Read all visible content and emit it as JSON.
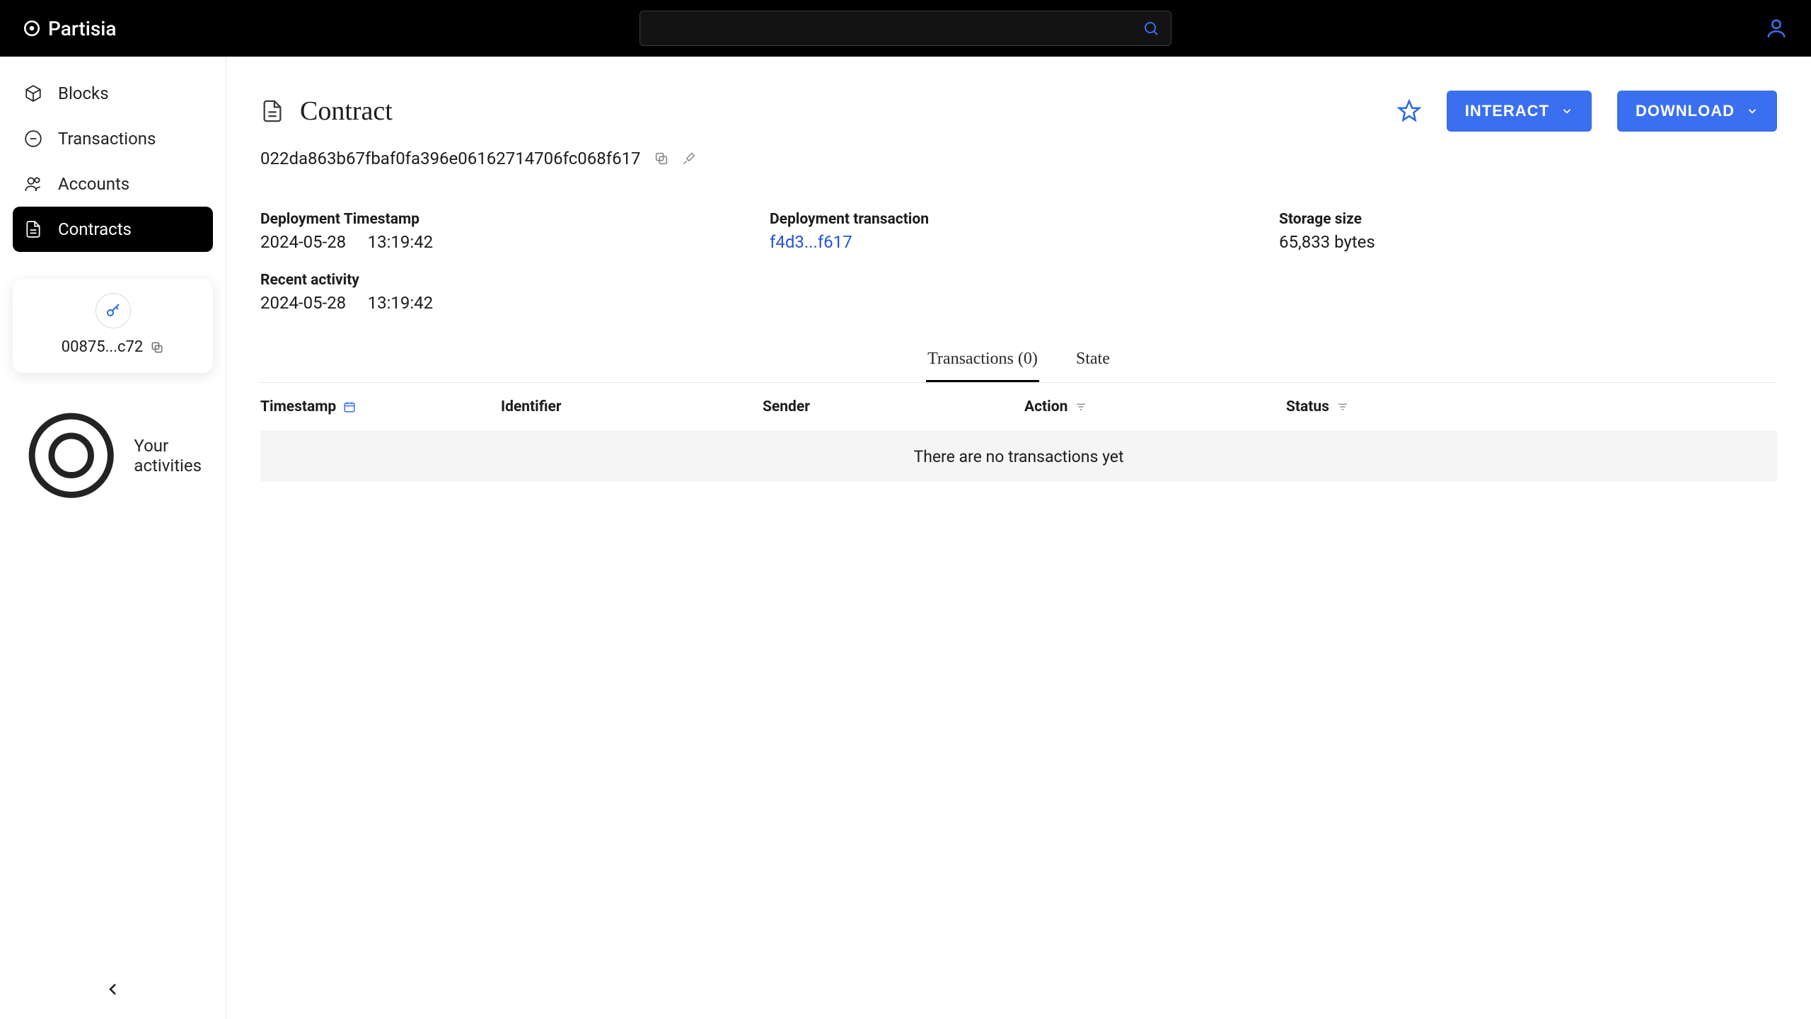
{
  "brand": "Partisia",
  "sidebar": {
    "items": [
      {
        "label": "Blocks"
      },
      {
        "label": "Transactions"
      },
      {
        "label": "Accounts"
      },
      {
        "label": "Contracts"
      }
    ],
    "account": {
      "id": "00875...c72"
    },
    "activities_label": "Your activities"
  },
  "page": {
    "title": "Contract",
    "id": "022da863b67fbaf0fa396e06162714706fc068f617",
    "interact_btn": "INTERACT",
    "download_btn": "DOWNLOAD"
  },
  "info": {
    "deploy_ts_label": "Deployment Timestamp",
    "deploy_ts_value": "2024-05-28  13:19:42",
    "deploy_tx_label": "Deployment transaction",
    "deploy_tx_value": "f4d3...f617",
    "storage_label": "Storage size",
    "storage_value": "65,833 bytes",
    "recent_label": "Recent activity",
    "recent_value": "2024-05-28  13:19:42"
  },
  "tabs": {
    "transactions": "Transactions (0)",
    "state": "State"
  },
  "table": {
    "cols": {
      "timestamp": "Timestamp",
      "identifier": "Identifier",
      "sender": "Sender",
      "action": "Action",
      "status": "Status"
    },
    "empty": "There are no transactions yet"
  }
}
